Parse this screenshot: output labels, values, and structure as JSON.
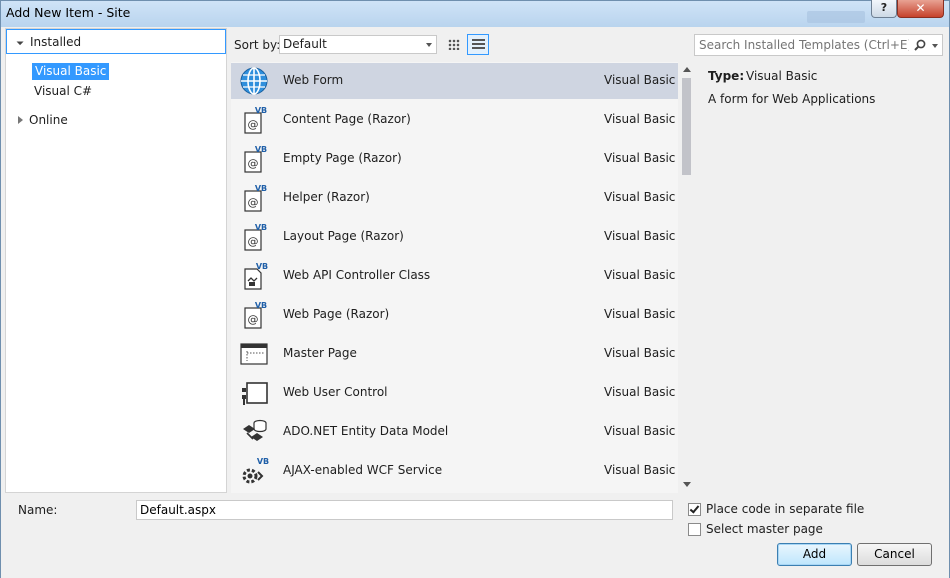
{
  "window": {
    "title": "Add New Item - Site",
    "help_label": "?",
    "close_label": "✕"
  },
  "tree": {
    "installed": "Installed",
    "visual_basic": "Visual Basic",
    "visual_csharp": "Visual C#",
    "online": "Online"
  },
  "toolbar": {
    "sort_label": "Sort by:",
    "sort_value": "Default",
    "search_placeholder": "Search Installed Templates (Ctrl+E)"
  },
  "templates": [
    {
      "name": "Web Form",
      "language": "Visual Basic",
      "icon": "globe-icon"
    },
    {
      "name": "Content Page (Razor)",
      "language": "Visual Basic",
      "icon": "vb-razor-page-icon"
    },
    {
      "name": "Empty Page (Razor)",
      "language": "Visual Basic",
      "icon": "vb-razor-page-icon"
    },
    {
      "name": "Helper (Razor)",
      "language": "Visual Basic",
      "icon": "vb-razor-page-icon"
    },
    {
      "name": "Layout Page (Razor)",
      "language": "Visual Basic",
      "icon": "vb-razor-page-icon"
    },
    {
      "name": "Web API Controller Class",
      "language": "Visual Basic",
      "icon": "vb-controller-icon"
    },
    {
      "name": "Web Page (Razor)",
      "language": "Visual Basic",
      "icon": "vb-razor-page-icon"
    },
    {
      "name": "Master Page",
      "language": "Visual Basic",
      "icon": "master-page-icon"
    },
    {
      "name": "Web User Control",
      "language": "Visual Basic",
      "icon": "user-control-icon"
    },
    {
      "name": "ADO.NET Entity Data Model",
      "language": "Visual Basic",
      "icon": "entity-model-icon"
    },
    {
      "name": "AJAX-enabled WCF Service",
      "language": "Visual Basic",
      "icon": "vb-wcf-service-icon"
    }
  ],
  "details": {
    "type_label": "Type:",
    "type_value": "Visual Basic",
    "description": "A form for Web Applications"
  },
  "footer": {
    "name_label": "Name:",
    "name_value": "Default.aspx",
    "separate_file_label": "Place code in separate file",
    "separate_file_checked": true,
    "master_page_label": "Select master page",
    "master_page_checked": false,
    "add_label": "Add",
    "cancel_label": "Cancel"
  },
  "colors": {
    "selection": "#3399ff",
    "selected_row": "#cfd5e1",
    "vb_badge": "#1f5fa8"
  }
}
